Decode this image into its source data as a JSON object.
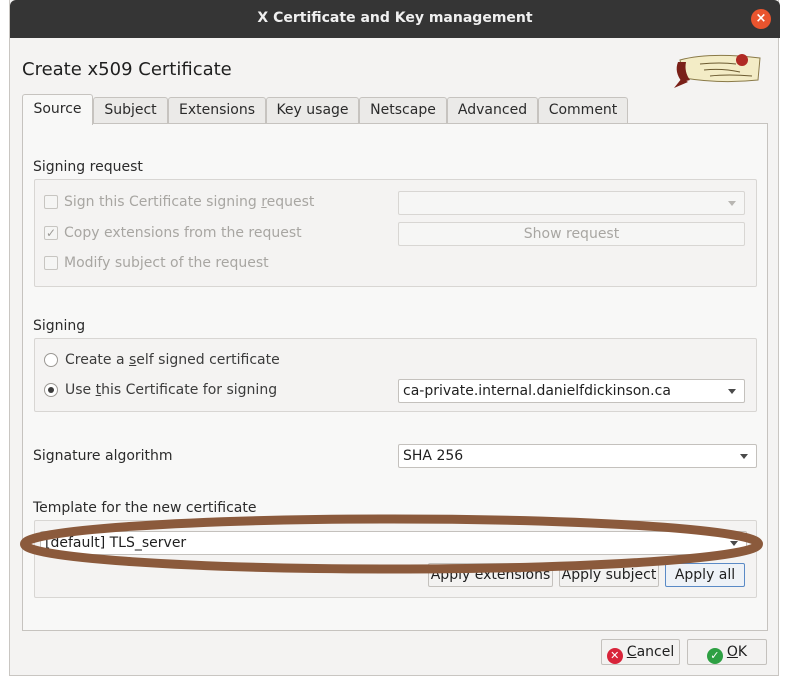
{
  "window": {
    "title": "X Certificate and Key management",
    "close_glyph": "×"
  },
  "dialog": {
    "title": "Create x509 Certificate"
  },
  "tabs": [
    {
      "label": "Source"
    },
    {
      "label": "Subject"
    },
    {
      "label": "Extensions"
    },
    {
      "label": "Key usage"
    },
    {
      "label": "Netscape"
    },
    {
      "label": "Advanced"
    },
    {
      "label": "Comment"
    }
  ],
  "signing_request": {
    "label": "Signing request",
    "sign_csr": {
      "pre": "Sign this Certificate signing ",
      "key": "r",
      "post": "equest",
      "checked": false
    },
    "copy_ext": {
      "label": "Copy extensions from the request",
      "checked": true
    },
    "modify_subject": {
      "label": "Modify subject of the request",
      "checked": false
    },
    "request_combo": {
      "value": ""
    },
    "show_request": {
      "label": "Show request"
    }
  },
  "signing": {
    "label": "Signing",
    "self_signed": {
      "pre": "Create a ",
      "key": "s",
      "post": "elf signed certificate",
      "checked": false
    },
    "use_cert": {
      "pre": "Use ",
      "key": "t",
      "post": "his Certificate for signing",
      "checked": true
    },
    "ca_combo": {
      "value": "ca-private.internal.danielfdickinson.ca"
    }
  },
  "signature_algorithm": {
    "label": "Signature algorithm",
    "value": "SHA 256"
  },
  "template": {
    "label": "Template for the new certificate",
    "value": "[default] TLS_server",
    "apply_extensions": "Apply extensions",
    "apply_subject": "Apply subject",
    "apply_all": "Apply all"
  },
  "footer": {
    "cancel": {
      "key": "C",
      "post": "ancel"
    },
    "ok": {
      "key": "O",
      "post": "K"
    }
  },
  "colors": {
    "annotation_ellipse": "#8b5a3c",
    "cancel_icon": "#d8243a",
    "ok_icon": "#2ea043"
  }
}
